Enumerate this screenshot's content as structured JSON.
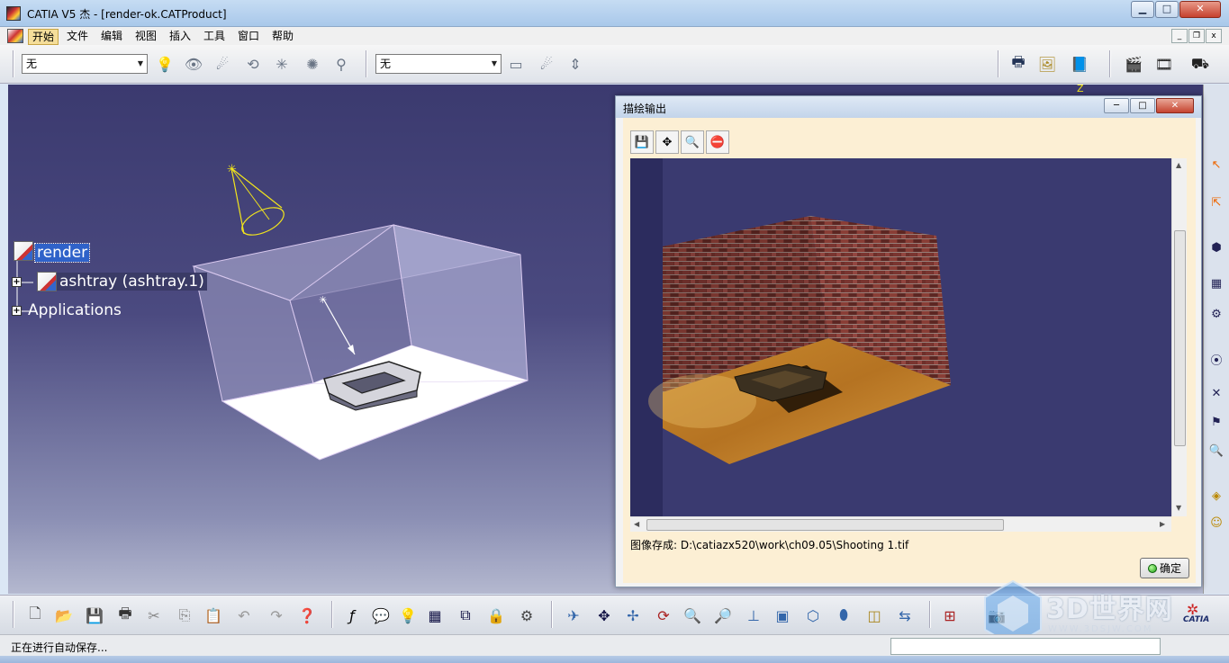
{
  "window": {
    "title": "CATIA V5  杰 - [render-ok.CATProduct]",
    "controls": {
      "minimize": "▁",
      "maximize": "□",
      "close": "✕"
    }
  },
  "menu": {
    "items": [
      "开始",
      "文件",
      "编辑",
      "视图",
      "插入",
      "工具",
      "窗口",
      "帮助"
    ],
    "mdi": {
      "minimize": "_",
      "restore": "❐",
      "close": "x"
    }
  },
  "toolbar_top": {
    "select1": "无",
    "select2": "无"
  },
  "tree": {
    "root": "render",
    "child": "ashtray (ashtray.1)",
    "applications": "Applications"
  },
  "compass_axis": "Z",
  "dialog": {
    "title": "描绘输出",
    "controls": {
      "minimize": "─",
      "maximize": "□",
      "close": "✕"
    },
    "tools": [
      "save-icon",
      "fit-all-icon",
      "zoom-icon",
      "stop-icon"
    ],
    "saved_path": "图像存成: D:\\catiazx520\\work\\ch09.05\\Shooting 1.tif",
    "ok_label": "确定"
  },
  "status": {
    "text": "正在进行自动保存..."
  },
  "watermark": {
    "text": "3D世界网",
    "url": "WWW.3DSJW.COM"
  },
  "catia_logo": "CATIA"
}
